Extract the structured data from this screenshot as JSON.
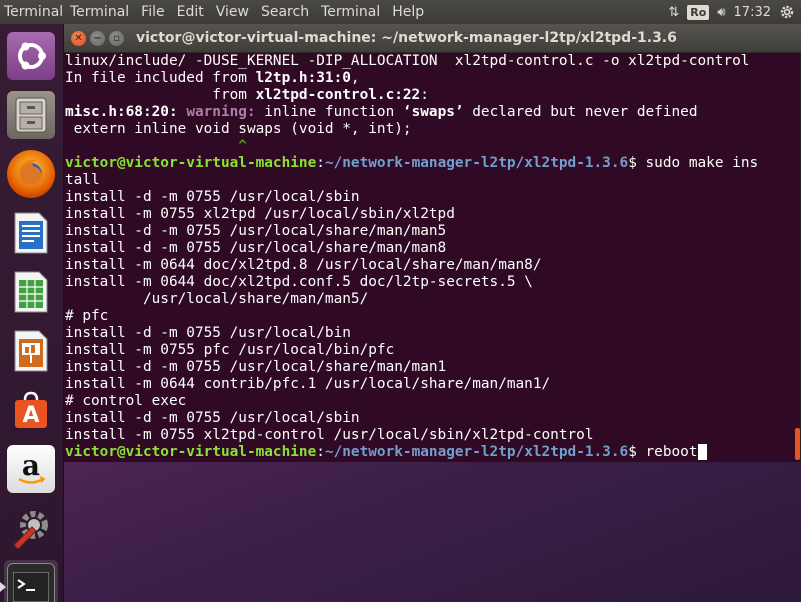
{
  "top_panel": {
    "app_title": "Terminal",
    "menus": [
      "Terminal",
      "File",
      "Edit",
      "View",
      "Search",
      "Terminal",
      "Help"
    ],
    "keyboard_layout": "Ro",
    "clock": "17:32"
  },
  "launcher": {
    "items": [
      {
        "name": "ubuntu-dash",
        "icon": "ubuntu-logo-icon",
        "color": "#e95420"
      },
      {
        "name": "files",
        "icon": "file-cabinet-icon",
        "color": "#c6bfb6"
      },
      {
        "name": "firefox",
        "icon": "firefox-icon",
        "color": "#e66000"
      },
      {
        "name": "writer",
        "icon": "libreoffice-writer-icon",
        "color": "#2a6fc9"
      },
      {
        "name": "calc",
        "icon": "libreoffice-calc-icon",
        "color": "#3fa13f"
      },
      {
        "name": "impress",
        "icon": "libreoffice-impress-icon",
        "color": "#d06a1c"
      },
      {
        "name": "software-center",
        "icon": "software-center-icon",
        "color": "#e95420"
      },
      {
        "name": "amazon",
        "icon": "amazon-icon",
        "color": "#f2f2f2"
      },
      {
        "name": "system-settings",
        "icon": "settings-icon",
        "color": "#9a9a9a"
      },
      {
        "name": "terminal",
        "icon": "terminal-icon",
        "color": "#2b2b2b"
      }
    ]
  },
  "window": {
    "title": "victor@victor-virtual-machine: ~/network-manager-l2tp/xl2tpd-1.3.6"
  },
  "terminal": {
    "l1": "linux/include/ -DUSE_KERNEL -DIP_ALLOCATION  xl2tpd-control.c -o xl2tpd-control",
    "l2_pre": "In file included from ",
    "l2_file": "l2tp.h:31:0",
    "l2_post": ",",
    "l3_pre": "                 from ",
    "l3_file": "xl2tpd-control.c:22",
    "l3_post": ":",
    "l4_loc": "misc.h:68:20:",
    "l4_warn": "warning:",
    "l4_msg_a": " inline function ",
    "l4_func": "‘swaps’",
    "l4_msg_b": " declared but never defined",
    "l5": " extern inline void swaps (void *, int);",
    "l6": "                    ^",
    "prompt_user": "victor@victor-virtual-machine",
    "prompt_sep": ":",
    "prompt_path": "~/network-manager-l2tp/xl2tpd-1.3.6",
    "prompt_dollar": "$",
    "cmd1_a": " sudo make ins",
    "cmd1_b": "tall",
    "out": [
      "install -d -m 0755 /usr/local/sbin",
      "install -m 0755 xl2tpd /usr/local/sbin/xl2tpd",
      "install -d -m 0755 /usr/local/share/man/man5",
      "install -d -m 0755 /usr/local/share/man/man8",
      "install -m 0644 doc/xl2tpd.8 /usr/local/share/man/man8/",
      "install -m 0644 doc/xl2tpd.conf.5 doc/l2tp-secrets.5 \\",
      "         /usr/local/share/man/man5/",
      "# pfc",
      "install -d -m 0755 /usr/local/bin",
      "install -m 0755 pfc /usr/local/bin/pfc",
      "install -d -m 0755 /usr/local/share/man/man1",
      "install -m 0644 contrib/pfc.1 /usr/local/share/man/man1/",
      "# control exec",
      "install -d -m 0755 /usr/local/sbin",
      "install -m 0755 xl2tpd-control /usr/local/sbin/xl2tpd-control"
    ],
    "cmd2": " reboot"
  }
}
